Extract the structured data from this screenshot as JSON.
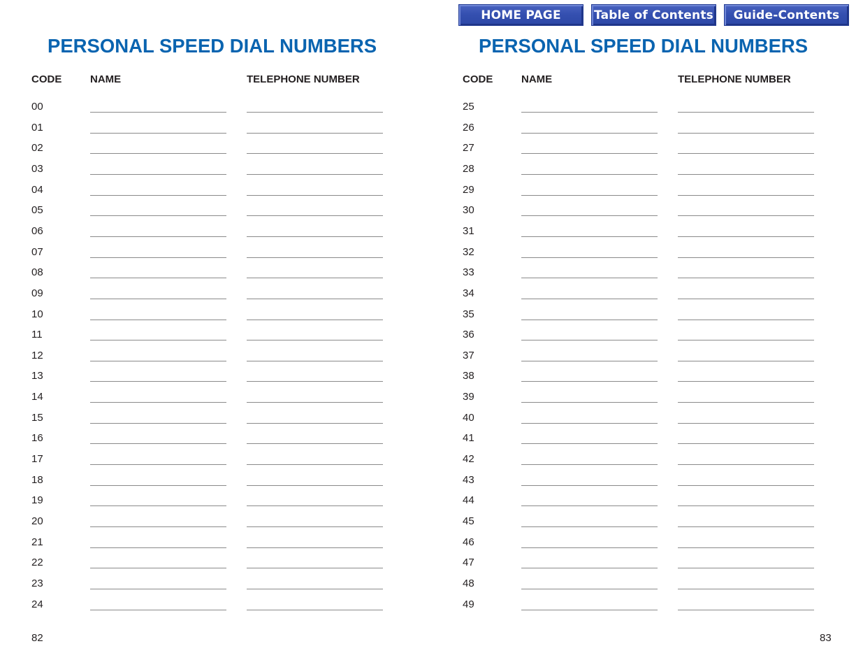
{
  "nav": {
    "buttons": [
      {
        "label": "HOME PAGE"
      },
      {
        "label": "Table of Contents"
      },
      {
        "label": "Guide-Contents"
      }
    ]
  },
  "pages": [
    {
      "title": "PERSONAL SPEED DIAL NUMBERS",
      "headers": {
        "code": "CODE",
        "name": "NAME",
        "telephone": "TELEPHONE NUMBER"
      },
      "codes": [
        "00",
        "01",
        "02",
        "03",
        "04",
        "05",
        "06",
        "07",
        "08",
        "09",
        "10",
        "11",
        "12",
        "13",
        "14",
        "15",
        "16",
        "17",
        "18",
        "19",
        "20",
        "21",
        "22",
        "23",
        "24"
      ],
      "page_number": "82"
    },
    {
      "title": "PERSONAL SPEED DIAL NUMBERS",
      "headers": {
        "code": "CODE",
        "name": "NAME",
        "telephone": "TELEPHONE NUMBER"
      },
      "codes": [
        "25",
        "26",
        "27",
        "28",
        "29",
        "30",
        "31",
        "32",
        "33",
        "34",
        "35",
        "36",
        "37",
        "38",
        "39",
        "40",
        "41",
        "42",
        "43",
        "44",
        "45",
        "46",
        "47",
        "48",
        "49"
      ],
      "page_number": "83"
    }
  ]
}
